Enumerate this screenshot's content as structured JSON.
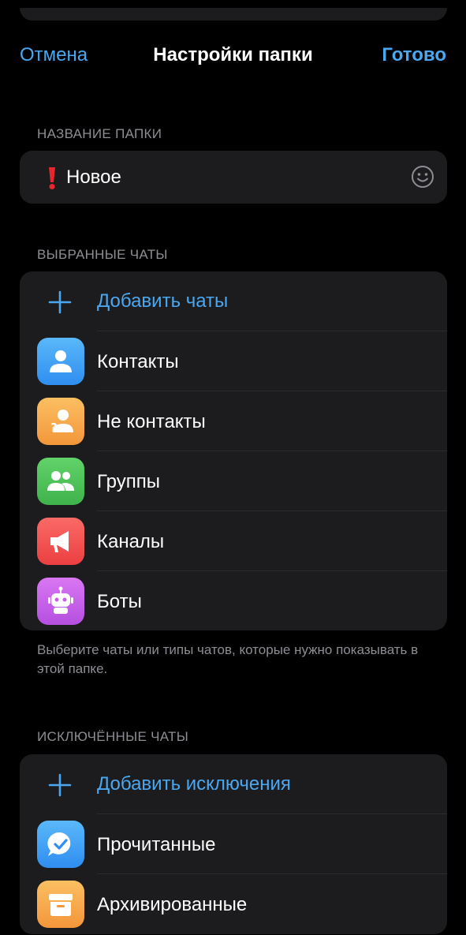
{
  "nav": {
    "cancel_label": "Отмена",
    "title": "Настройки папки",
    "done_label": "Готово"
  },
  "folder_name_section": {
    "header": "НАЗВАНИЕ ПАПКИ",
    "emoji_icon": "red-exclamation-icon",
    "value": "Новое",
    "emoji_picker_icon": "smiley-icon"
  },
  "included_section": {
    "header": "ВЫБРАННЫЕ ЧАТЫ",
    "add_label": "Добавить чаты",
    "items": [
      {
        "label": "Контакты",
        "icon": "person-icon",
        "color": "#3fa1f2"
      },
      {
        "label": "Не контакты",
        "icon": "unknown-person-icon",
        "color": "#f7a64a"
      },
      {
        "label": "Группы",
        "icon": "group-icon",
        "color": "#4fc259"
      },
      {
        "label": "Каналы",
        "icon": "megaphone-icon",
        "color": "#f2514f"
      },
      {
        "label": "Боты",
        "icon": "robot-icon",
        "color": "#c660e8"
      }
    ],
    "footnote": "Выберите чаты или типы чатов, которые нужно показывать в этой папке."
  },
  "excluded_section": {
    "header": "ИСКЛЮЧЁННЫЕ ЧАТЫ",
    "add_label": "Добавить исключения",
    "items": [
      {
        "label": "Прочитанные",
        "icon": "read-check-icon",
        "color": "#3fa1f2"
      },
      {
        "label": "Архивированные",
        "icon": "archive-box-icon",
        "color": "#f6a53a"
      }
    ]
  },
  "colors": {
    "background": "#000000",
    "card": "#1c1c1e",
    "accent": "#4aa7f0",
    "secondary_text": "#8d8d93"
  }
}
